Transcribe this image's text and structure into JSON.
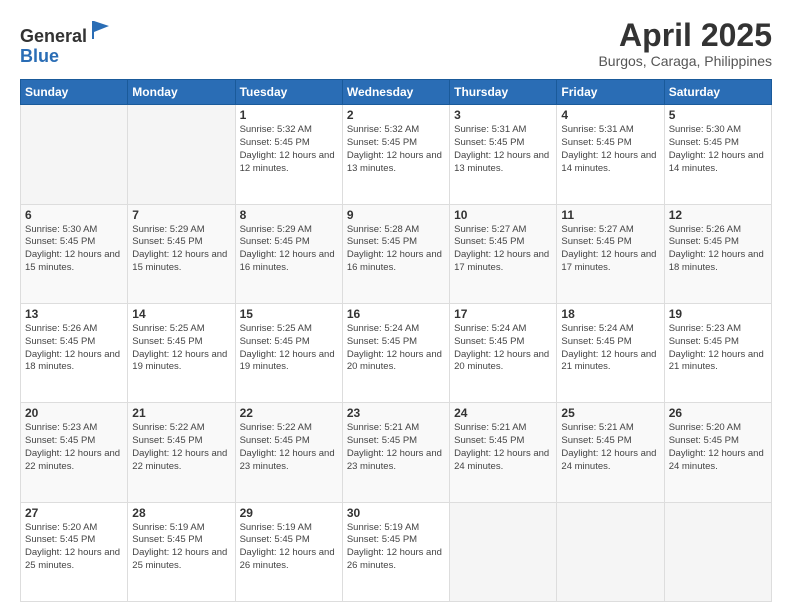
{
  "logo": {
    "general": "General",
    "blue": "Blue"
  },
  "header": {
    "month": "April 2025",
    "location": "Burgos, Caraga, Philippines"
  },
  "weekdays": [
    "Sunday",
    "Monday",
    "Tuesday",
    "Wednesday",
    "Thursday",
    "Friday",
    "Saturday"
  ],
  "weeks": [
    [
      {
        "day": "",
        "info": ""
      },
      {
        "day": "",
        "info": ""
      },
      {
        "day": "1",
        "info": "Sunrise: 5:32 AM\nSunset: 5:45 PM\nDaylight: 12 hours and 12 minutes."
      },
      {
        "day": "2",
        "info": "Sunrise: 5:32 AM\nSunset: 5:45 PM\nDaylight: 12 hours and 13 minutes."
      },
      {
        "day": "3",
        "info": "Sunrise: 5:31 AM\nSunset: 5:45 PM\nDaylight: 12 hours and 13 minutes."
      },
      {
        "day": "4",
        "info": "Sunrise: 5:31 AM\nSunset: 5:45 PM\nDaylight: 12 hours and 14 minutes."
      },
      {
        "day": "5",
        "info": "Sunrise: 5:30 AM\nSunset: 5:45 PM\nDaylight: 12 hours and 14 minutes."
      }
    ],
    [
      {
        "day": "6",
        "info": "Sunrise: 5:30 AM\nSunset: 5:45 PM\nDaylight: 12 hours and 15 minutes."
      },
      {
        "day": "7",
        "info": "Sunrise: 5:29 AM\nSunset: 5:45 PM\nDaylight: 12 hours and 15 minutes."
      },
      {
        "day": "8",
        "info": "Sunrise: 5:29 AM\nSunset: 5:45 PM\nDaylight: 12 hours and 16 minutes."
      },
      {
        "day": "9",
        "info": "Sunrise: 5:28 AM\nSunset: 5:45 PM\nDaylight: 12 hours and 16 minutes."
      },
      {
        "day": "10",
        "info": "Sunrise: 5:27 AM\nSunset: 5:45 PM\nDaylight: 12 hours and 17 minutes."
      },
      {
        "day": "11",
        "info": "Sunrise: 5:27 AM\nSunset: 5:45 PM\nDaylight: 12 hours and 17 minutes."
      },
      {
        "day": "12",
        "info": "Sunrise: 5:26 AM\nSunset: 5:45 PM\nDaylight: 12 hours and 18 minutes."
      }
    ],
    [
      {
        "day": "13",
        "info": "Sunrise: 5:26 AM\nSunset: 5:45 PM\nDaylight: 12 hours and 18 minutes."
      },
      {
        "day": "14",
        "info": "Sunrise: 5:25 AM\nSunset: 5:45 PM\nDaylight: 12 hours and 19 minutes."
      },
      {
        "day": "15",
        "info": "Sunrise: 5:25 AM\nSunset: 5:45 PM\nDaylight: 12 hours and 19 minutes."
      },
      {
        "day": "16",
        "info": "Sunrise: 5:24 AM\nSunset: 5:45 PM\nDaylight: 12 hours and 20 minutes."
      },
      {
        "day": "17",
        "info": "Sunrise: 5:24 AM\nSunset: 5:45 PM\nDaylight: 12 hours and 20 minutes."
      },
      {
        "day": "18",
        "info": "Sunrise: 5:24 AM\nSunset: 5:45 PM\nDaylight: 12 hours and 21 minutes."
      },
      {
        "day": "19",
        "info": "Sunrise: 5:23 AM\nSunset: 5:45 PM\nDaylight: 12 hours and 21 minutes."
      }
    ],
    [
      {
        "day": "20",
        "info": "Sunrise: 5:23 AM\nSunset: 5:45 PM\nDaylight: 12 hours and 22 minutes."
      },
      {
        "day": "21",
        "info": "Sunrise: 5:22 AM\nSunset: 5:45 PM\nDaylight: 12 hours and 22 minutes."
      },
      {
        "day": "22",
        "info": "Sunrise: 5:22 AM\nSunset: 5:45 PM\nDaylight: 12 hours and 23 minutes."
      },
      {
        "day": "23",
        "info": "Sunrise: 5:21 AM\nSunset: 5:45 PM\nDaylight: 12 hours and 23 minutes."
      },
      {
        "day": "24",
        "info": "Sunrise: 5:21 AM\nSunset: 5:45 PM\nDaylight: 12 hours and 24 minutes."
      },
      {
        "day": "25",
        "info": "Sunrise: 5:21 AM\nSunset: 5:45 PM\nDaylight: 12 hours and 24 minutes."
      },
      {
        "day": "26",
        "info": "Sunrise: 5:20 AM\nSunset: 5:45 PM\nDaylight: 12 hours and 24 minutes."
      }
    ],
    [
      {
        "day": "27",
        "info": "Sunrise: 5:20 AM\nSunset: 5:45 PM\nDaylight: 12 hours and 25 minutes."
      },
      {
        "day": "28",
        "info": "Sunrise: 5:19 AM\nSunset: 5:45 PM\nDaylight: 12 hours and 25 minutes."
      },
      {
        "day": "29",
        "info": "Sunrise: 5:19 AM\nSunset: 5:45 PM\nDaylight: 12 hours and 26 minutes."
      },
      {
        "day": "30",
        "info": "Sunrise: 5:19 AM\nSunset: 5:45 PM\nDaylight: 12 hours and 26 minutes."
      },
      {
        "day": "",
        "info": ""
      },
      {
        "day": "",
        "info": ""
      },
      {
        "day": "",
        "info": ""
      }
    ]
  ]
}
